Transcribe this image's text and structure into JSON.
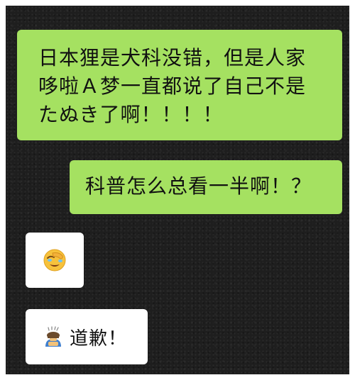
{
  "conversation": {
    "messages": [
      {
        "sender": "me",
        "lines": [
          "日本狸是犬科没错，但是人家",
          "哆啦Ａ梦一直都说了自己不是",
          "たぬき了啊！！！！"
        ]
      },
      {
        "sender": "me",
        "text": "科普怎么总看一半啊！？"
      },
      {
        "sender": "other",
        "emoji": "face-palm-laughing-emoji"
      },
      {
        "sender": "other",
        "emoji": "bowing-person-emoji",
        "text": "道歉！"
      }
    ]
  },
  "colors": {
    "sent_bubble": "#a5e161",
    "received_bubble": "#ffffff",
    "background": "#1e1e1e"
  }
}
